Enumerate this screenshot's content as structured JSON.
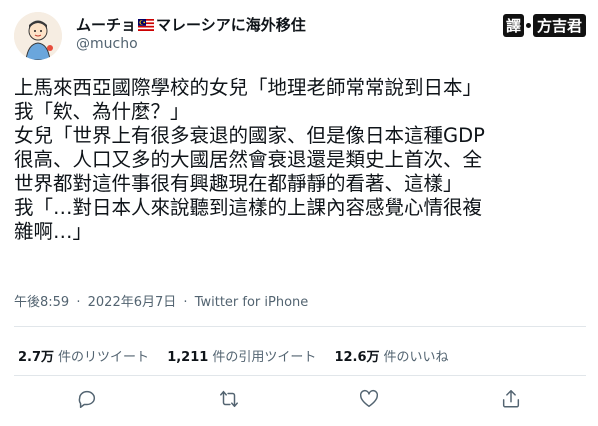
{
  "author": {
    "display_name": "ムーチョ",
    "location_suffix": "マレーシアに海外移住",
    "handle": "@mucho",
    "flag_icon": "malaysia-flag-icon"
  },
  "translator": {
    "char": "譯",
    "name": "方吉君"
  },
  "tweet": {
    "text": "上馬來西亞國際學校的女兒「地理老師常常說到日本」\n我「欸、為什麼？」\n女兒「世界上有很多衰退的國家、但是像日本這種GDP\n很高、人口又多的大國居然會衰退還是類史上首次、全\n世界都對這件事很有興趣現在都靜靜的看著、這樣」\n我「…對日本人來說聽到這樣的上課內容感覺心情很複\n雜啊…」"
  },
  "meta": {
    "time": "午後8:59",
    "date": "2022年6月7日",
    "separator": "·",
    "client": "Twitter for iPhone"
  },
  "stats": {
    "retweets_count": "2.7万",
    "retweets_label": "件のリツイート",
    "quotes_count": "1,211",
    "quotes_label": "件の引用ツイート",
    "likes_count": "12.6万",
    "likes_label": "件のいいね"
  },
  "icons": {
    "reply": "reply-icon",
    "retweet": "retweet-icon",
    "like": "heart-icon",
    "share": "share-icon"
  },
  "colors": {
    "text": "#0f1419",
    "secondary": "#536471",
    "divider": "#e1e6ea"
  }
}
